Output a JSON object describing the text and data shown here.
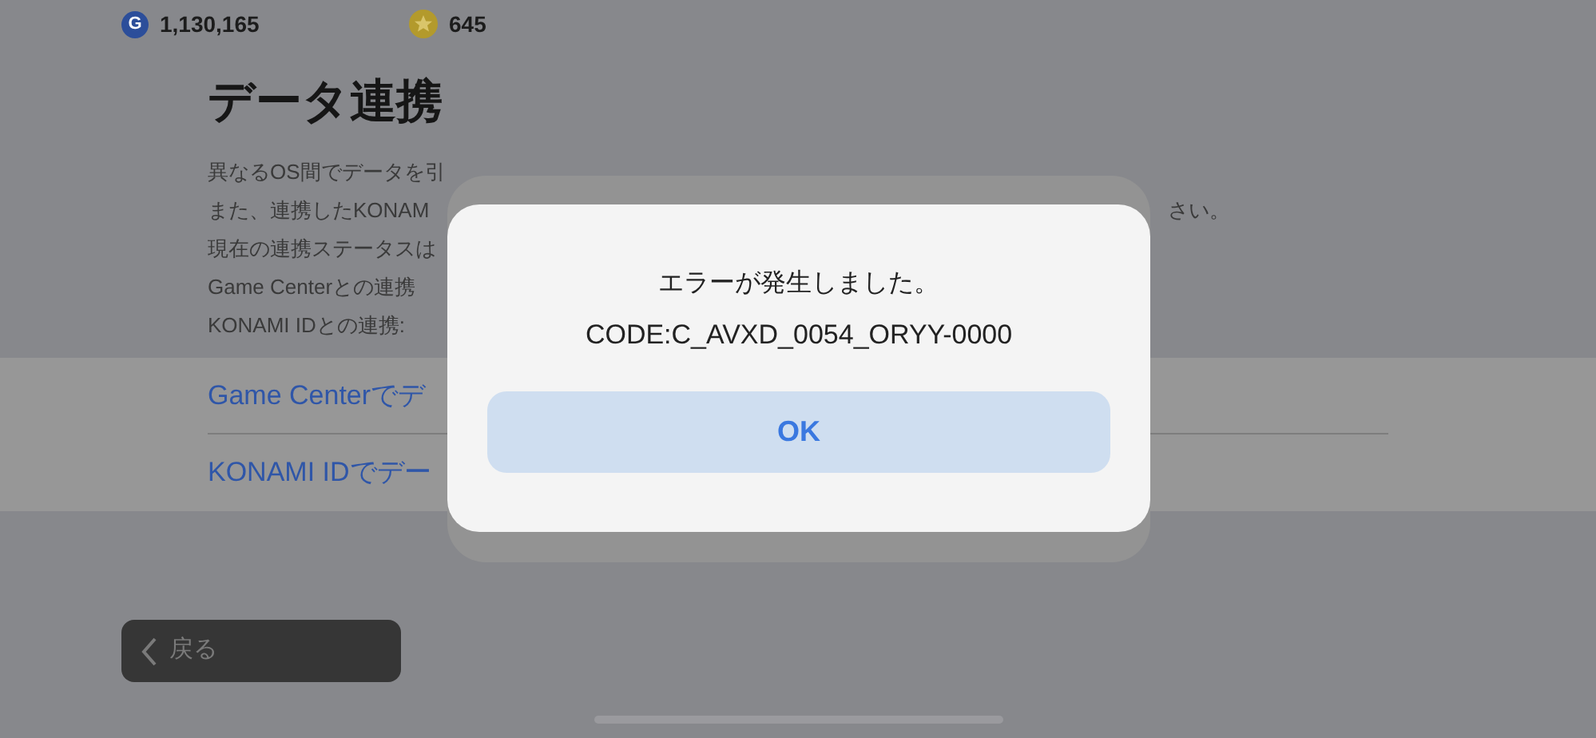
{
  "currencies": [
    {
      "kind": "coin",
      "symbol": "G",
      "value": "1,130,165"
    },
    {
      "kind": "star",
      "value": "645"
    }
  ],
  "title": "データ連携",
  "description_lines": [
    {
      "left": "異なるOS間でデータを引"
    },
    {
      "left": "また、連携したKONAM",
      "right": "さい。"
    },
    {
      "left": "現在の連携ステータスは"
    },
    {
      "left": "Game Centerとの連携"
    },
    {
      "left": "KONAMI IDとの連携: "
    }
  ],
  "options": [
    {
      "label": "Game Centerでデ"
    },
    {
      "label": "KONAMI IDでデー"
    }
  ],
  "back_button": {
    "label": "戻る"
  },
  "dialog": {
    "message": "エラーが発生しました。",
    "code": "CODE:C_AVXD_0054_ORYY-0000",
    "button": "OK"
  }
}
